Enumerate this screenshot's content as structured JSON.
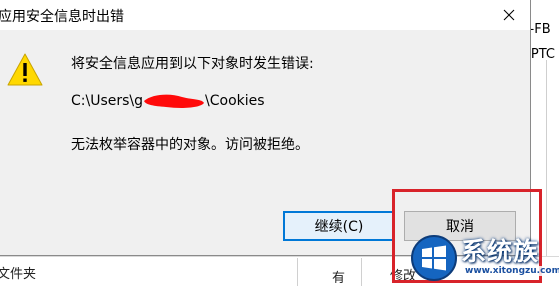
{
  "dialog": {
    "title": "应用安全信息时出错",
    "message": "将安全信息应用到以下对象时发生错误:",
    "path_prefix": "C:\\Users\\g",
    "path_suffix": "\\Cookies",
    "detail": "无法枚举容器中的对象。访问被拒绝。",
    "buttons": {
      "continue": "继续(C)",
      "cancel": "取消"
    },
    "icon": "warning-icon",
    "close_icon": "close-icon"
  },
  "background": {
    "text1": "P-FB",
    "text2": "APTC",
    "folder_label": "文件夹",
    "col_you": "有",
    "col_modify": "修改"
  },
  "watermark": {
    "brand": "系统族",
    "url": "www.xitongzu.com"
  },
  "colors": {
    "highlight": "#d8232a",
    "focus": "#0078d7",
    "dialog_bg": "#f0f0f0",
    "warning": "#ffd800"
  }
}
